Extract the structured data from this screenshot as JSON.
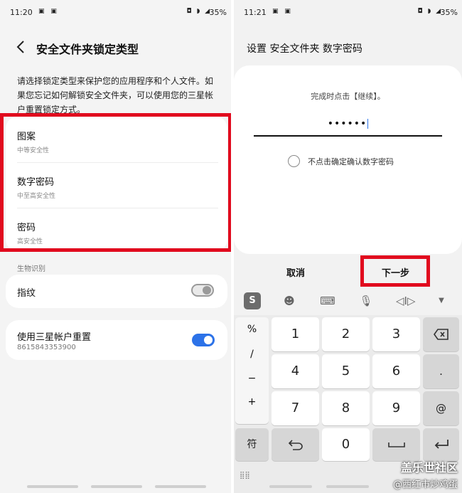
{
  "left": {
    "status": {
      "time": "11:20",
      "battery": "35%"
    },
    "title": "安全文件夹锁定类型",
    "description": "请选择锁定类型来保护您的应用程序和个人文件。如果您忘记如何解锁安全文件夹，可以使用您的三星帐户重置锁定方式。",
    "options": [
      {
        "title": "图案",
        "subtitle": "中等安全性"
      },
      {
        "title": "数字密码",
        "subtitle": "中至高安全性"
      },
      {
        "title": "密码",
        "subtitle": "高安全性"
      }
    ],
    "biometrics_label": "生物识别",
    "fingerprint": {
      "label": "指纹",
      "enabled": false
    },
    "samsung_reset": {
      "label": "使用三星帐户重置",
      "account": "8615843353900",
      "enabled": true
    },
    "highlight_color": "#e10a1e"
  },
  "right": {
    "status": {
      "time": "11:21",
      "battery": "35%"
    },
    "title": "设置 安全文件夹 数字密码",
    "instruction": "完成时点击【继续】。",
    "pin_masked": "••••••",
    "checkbox_label": "不点击确定确认数字密码",
    "cancel_label": "取消",
    "next_label": "下一步",
    "toolbar_icons": [
      "sogou-logo-icon",
      "emoji-icon",
      "keyboard-icon",
      "microphone-icon",
      "cursor-move-icon",
      "collapse-icon"
    ],
    "keyboard": {
      "symbols": [
        "%",
        "/",
        "−",
        "+"
      ],
      "row1": [
        "1",
        "2",
        "3"
      ],
      "row2": [
        "4",
        "5",
        "6"
      ],
      "row3": [
        "7",
        "8",
        "9"
      ],
      "side": [
        ".",
        "@"
      ],
      "fu": "符",
      "zero": "0"
    }
  },
  "watermark": {
    "line1": "盖乐世社区",
    "line2": "@西红市炒鸡蛋"
  },
  "accent": "#2c72e8"
}
